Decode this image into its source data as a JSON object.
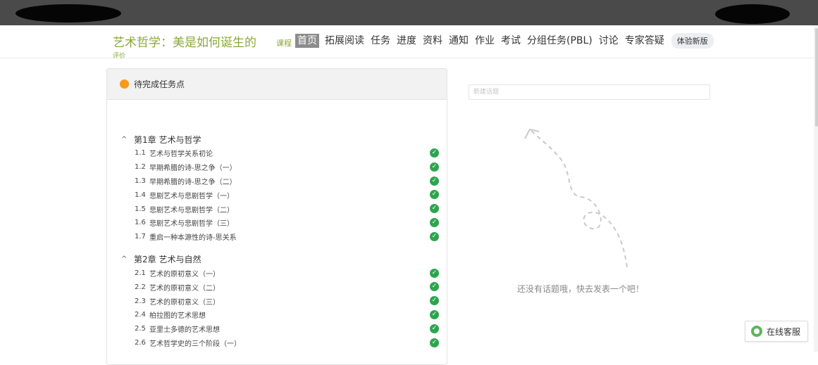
{
  "header": {
    "course_title": "艺术哲学：美是如何诞生的",
    "course_tag": "课程",
    "nav": [
      {
        "label": "首页",
        "active": true
      },
      {
        "label": "拓展阅读"
      },
      {
        "label": "任务"
      },
      {
        "label": "进度"
      },
      {
        "label": "资料"
      },
      {
        "label": "通知"
      },
      {
        "label": "作业"
      },
      {
        "label": "考试"
      },
      {
        "label": "分组任务(PBL)"
      },
      {
        "label": "讨论"
      },
      {
        "label": "专家答疑"
      }
    ],
    "new_version_label": "体验新版",
    "overflow_label": "评价"
  },
  "tasks": {
    "panel_title": "待完成任务点",
    "chapters": [
      {
        "title": "第1章 艺术与哲学",
        "lessons": [
          {
            "num": "1.1",
            "title": "艺术与哲学关系初论"
          },
          {
            "num": "1.2",
            "title": "早期希腊的诗-思之争（一）"
          },
          {
            "num": "1.3",
            "title": "早期希腊的诗-思之争（二）"
          },
          {
            "num": "1.4",
            "title": "悲剧艺术与悲剧哲学（一）"
          },
          {
            "num": "1.5",
            "title": "悲剧艺术与悲剧哲学（二）"
          },
          {
            "num": "1.6",
            "title": "悲剧艺术与悲剧哲学（三）"
          },
          {
            "num": "1.7",
            "title": "重启一种本源性的诗-思关系"
          }
        ]
      },
      {
        "title": "第2章 艺术与自然",
        "lessons": [
          {
            "num": "2.1",
            "title": "艺术的原初意义（一）"
          },
          {
            "num": "2.2",
            "title": "艺术的原初意义（二）"
          },
          {
            "num": "2.3",
            "title": "艺术的原初意义（三）"
          },
          {
            "num": "2.4",
            "title": "柏拉图的艺术思想"
          },
          {
            "num": "2.5",
            "title": "亚里士多德的艺术思想"
          },
          {
            "num": "2.6",
            "title": "艺术哲学史的三个阶段（一）"
          }
        ]
      }
    ]
  },
  "discussion": {
    "input_placeholder": "新建话题",
    "empty_text": "还没有话题哦，快去发表一个吧！"
  },
  "service": {
    "label": "在线客服"
  },
  "colors": {
    "accent_green": "#8aa83a",
    "check_green": "#2ea44f",
    "pending_orange": "#f79a1c",
    "topbar": "#4a4a4a"
  }
}
